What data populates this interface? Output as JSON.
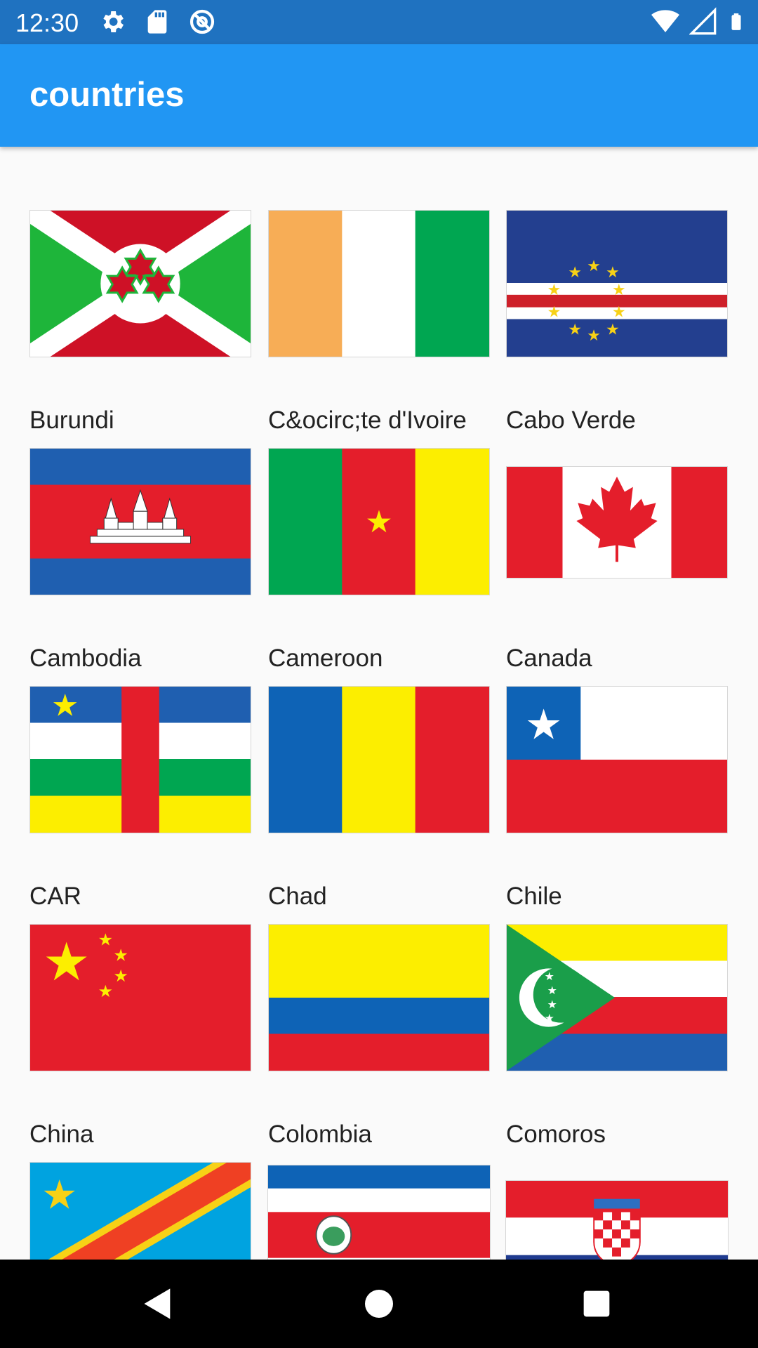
{
  "status_bar": {
    "time": "12:30",
    "left_icons": [
      "gear-icon",
      "sd-card-icon",
      "at-sign-icon"
    ],
    "right_icons": [
      "wifi-icon",
      "cell-signal-icon",
      "battery-icon"
    ]
  },
  "app_bar": {
    "title": "countries"
  },
  "countries": [
    {
      "name": "Burundi",
      "flag": "burundi-flag-icon"
    },
    {
      "name": "C&ocirc;te d'Ivoire",
      "flag": "cote-divoire-flag-icon"
    },
    {
      "name": "Cabo Verde",
      "flag": "cabo-verde-flag-icon"
    },
    {
      "name": "Cambodia",
      "flag": "cambodia-flag-icon"
    },
    {
      "name": "Cameroon",
      "flag": "cameroon-flag-icon"
    },
    {
      "name": "Canada",
      "flag": "canada-flag-icon"
    },
    {
      "name": "CAR",
      "flag": "car-flag-icon"
    },
    {
      "name": "Chad",
      "flag": "chad-flag-icon"
    },
    {
      "name": "Chile",
      "flag": "chile-flag-icon"
    },
    {
      "name": "China",
      "flag": "china-flag-icon"
    },
    {
      "name": "Colombia",
      "flag": "colombia-flag-icon"
    },
    {
      "name": "Comoros",
      "flag": "comoros-flag-icon"
    },
    {
      "name": "",
      "flag": "dr-congo-flag-icon"
    },
    {
      "name": "",
      "flag": "costa-rica-flag-icon"
    },
    {
      "name": "",
      "flag": "croatia-flag-icon"
    }
  ],
  "nav_bar": {
    "buttons": [
      "back-icon",
      "home-icon",
      "recents-icon"
    ]
  }
}
